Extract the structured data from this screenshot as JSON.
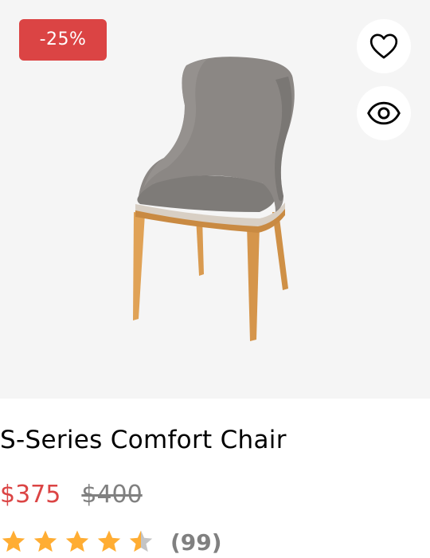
{
  "product": {
    "discount_label": "-25%",
    "name": "S-Series Comfort Chair",
    "price_current": "$375",
    "price_old": "$400",
    "rating": 4.5,
    "rating_max": 5,
    "review_count": "(99)",
    "image": "gray-upholstered-chair-wood-legs"
  },
  "actions": {
    "wishlist_icon": "heart-icon",
    "view_icon": "eye-icon"
  },
  "colors": {
    "accent": "#db4444",
    "star_filled": "#ffad33",
    "star_empty": "#c4c4c4",
    "muted_text": "#808080",
    "image_bg": "#f5f5f5"
  }
}
